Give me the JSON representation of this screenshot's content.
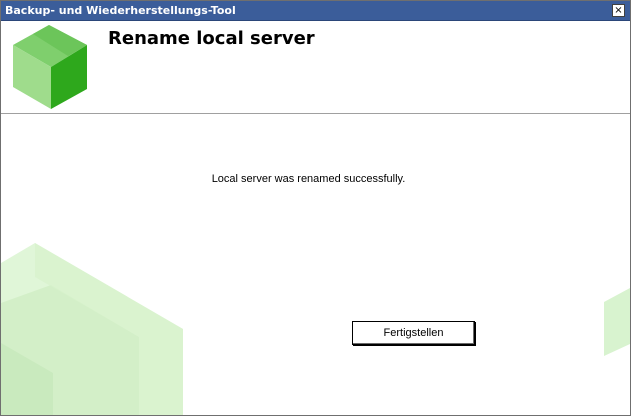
{
  "window": {
    "title": "Backup- und Wiederherstellungs-Tool",
    "close_glyph": "×"
  },
  "header": {
    "title": "Rename local server",
    "logo_icon": "green-cube-logo"
  },
  "main": {
    "message": "Local server was renamed successfully.",
    "finish_label": "Fertigstellen"
  },
  "colors": {
    "titlebar": "#3b5d9a",
    "logo_light": "#8fd47e",
    "logo_dark": "#2ea81c",
    "deco_green": "#d8f3cf"
  }
}
